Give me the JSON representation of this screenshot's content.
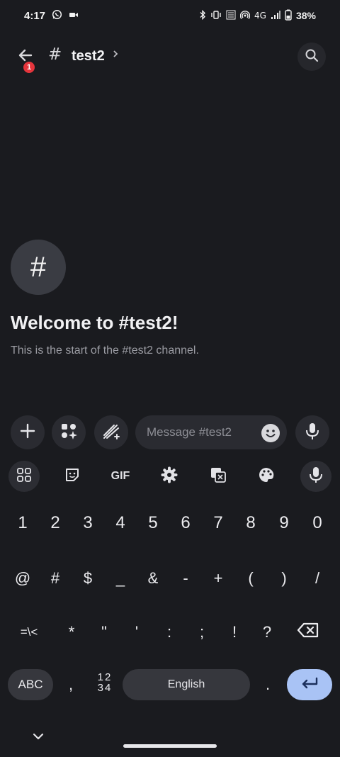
{
  "status_bar": {
    "time": "4:17",
    "battery": "38%",
    "network": "4G"
  },
  "header": {
    "channel_name": "test2",
    "unread_badge": "1",
    "hash": "#"
  },
  "welcome": {
    "icon_glyph": "#",
    "title": "Welcome to #test2!",
    "subtitle": "This is the start of the #test2 channel."
  },
  "composer": {
    "placeholder": "Message #test2"
  },
  "keyboard": {
    "toolbar": {
      "gif_label": "GIF"
    },
    "row1": [
      "1",
      "2",
      "3",
      "4",
      "5",
      "6",
      "7",
      "8",
      "9",
      "0"
    ],
    "row2": [
      "@",
      "#",
      "$",
      "_",
      "&",
      "-",
      "+",
      "(",
      ")",
      "/"
    ],
    "row3": [
      "=\\<",
      "*",
      "\"",
      "'",
      ":",
      ";",
      "!",
      "?"
    ],
    "abc_label": "ABC",
    "comma": ",",
    "num_top": "12",
    "num_bottom": "34",
    "space_label": "English",
    "period": "."
  },
  "colors": {
    "background": "#1a1b1f",
    "enter_key": "#a9c3f5",
    "badge": "#e5353c"
  }
}
